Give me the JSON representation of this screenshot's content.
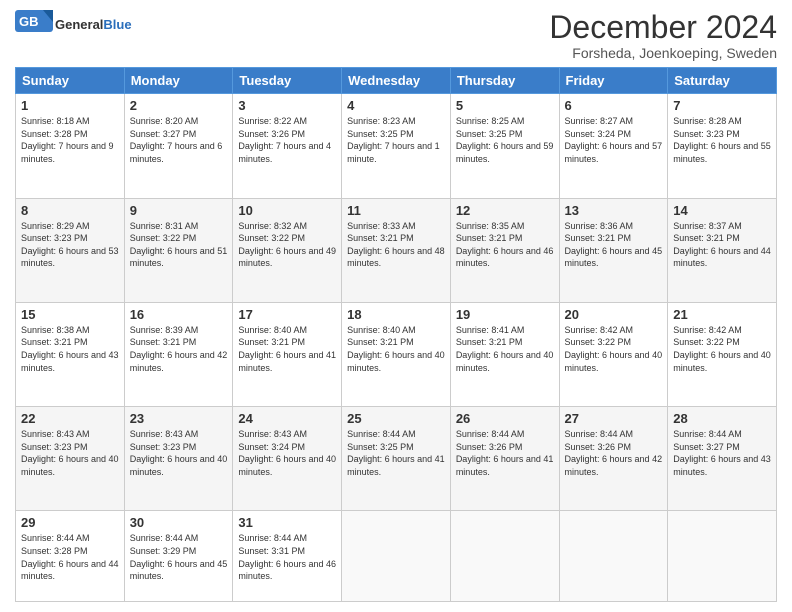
{
  "header": {
    "logo_general": "General",
    "logo_blue": "Blue",
    "month_title": "December 2024",
    "location": "Forsheda, Joenkoeping, Sweden"
  },
  "weekdays": [
    "Sunday",
    "Monday",
    "Tuesday",
    "Wednesday",
    "Thursday",
    "Friday",
    "Saturday"
  ],
  "weeks": [
    [
      {
        "day": "1",
        "sunrise": "8:18 AM",
        "sunset": "3:28 PM",
        "daylight": "7 hours and 9 minutes."
      },
      {
        "day": "2",
        "sunrise": "8:20 AM",
        "sunset": "3:27 PM",
        "daylight": "7 hours and 6 minutes."
      },
      {
        "day": "3",
        "sunrise": "8:22 AM",
        "sunset": "3:26 PM",
        "daylight": "7 hours and 4 minutes."
      },
      {
        "day": "4",
        "sunrise": "8:23 AM",
        "sunset": "3:25 PM",
        "daylight": "7 hours and 1 minute."
      },
      {
        "day": "5",
        "sunrise": "8:25 AM",
        "sunset": "3:25 PM",
        "daylight": "6 hours and 59 minutes."
      },
      {
        "day": "6",
        "sunrise": "8:27 AM",
        "sunset": "3:24 PM",
        "daylight": "6 hours and 57 minutes."
      },
      {
        "day": "7",
        "sunrise": "8:28 AM",
        "sunset": "3:23 PM",
        "daylight": "6 hours and 55 minutes."
      }
    ],
    [
      {
        "day": "8",
        "sunrise": "8:29 AM",
        "sunset": "3:23 PM",
        "daylight": "6 hours and 53 minutes."
      },
      {
        "day": "9",
        "sunrise": "8:31 AM",
        "sunset": "3:22 PM",
        "daylight": "6 hours and 51 minutes."
      },
      {
        "day": "10",
        "sunrise": "8:32 AM",
        "sunset": "3:22 PM",
        "daylight": "6 hours and 49 minutes."
      },
      {
        "day": "11",
        "sunrise": "8:33 AM",
        "sunset": "3:21 PM",
        "daylight": "6 hours and 48 minutes."
      },
      {
        "day": "12",
        "sunrise": "8:35 AM",
        "sunset": "3:21 PM",
        "daylight": "6 hours and 46 minutes."
      },
      {
        "day": "13",
        "sunrise": "8:36 AM",
        "sunset": "3:21 PM",
        "daylight": "6 hours and 45 minutes."
      },
      {
        "day": "14",
        "sunrise": "8:37 AM",
        "sunset": "3:21 PM",
        "daylight": "6 hours and 44 minutes."
      }
    ],
    [
      {
        "day": "15",
        "sunrise": "8:38 AM",
        "sunset": "3:21 PM",
        "daylight": "6 hours and 43 minutes."
      },
      {
        "day": "16",
        "sunrise": "8:39 AM",
        "sunset": "3:21 PM",
        "daylight": "6 hours and 42 minutes."
      },
      {
        "day": "17",
        "sunrise": "8:40 AM",
        "sunset": "3:21 PM",
        "daylight": "6 hours and 41 minutes."
      },
      {
        "day": "18",
        "sunrise": "8:40 AM",
        "sunset": "3:21 PM",
        "daylight": "6 hours and 40 minutes."
      },
      {
        "day": "19",
        "sunrise": "8:41 AM",
        "sunset": "3:21 PM",
        "daylight": "6 hours and 40 minutes."
      },
      {
        "day": "20",
        "sunrise": "8:42 AM",
        "sunset": "3:22 PM",
        "daylight": "6 hours and 40 minutes."
      },
      {
        "day": "21",
        "sunrise": "8:42 AM",
        "sunset": "3:22 PM",
        "daylight": "6 hours and 40 minutes."
      }
    ],
    [
      {
        "day": "22",
        "sunrise": "8:43 AM",
        "sunset": "3:23 PM",
        "daylight": "6 hours and 40 minutes."
      },
      {
        "day": "23",
        "sunrise": "8:43 AM",
        "sunset": "3:23 PM",
        "daylight": "6 hours and 40 minutes."
      },
      {
        "day": "24",
        "sunrise": "8:43 AM",
        "sunset": "3:24 PM",
        "daylight": "6 hours and 40 minutes."
      },
      {
        "day": "25",
        "sunrise": "8:44 AM",
        "sunset": "3:25 PM",
        "daylight": "6 hours and 41 minutes."
      },
      {
        "day": "26",
        "sunrise": "8:44 AM",
        "sunset": "3:26 PM",
        "daylight": "6 hours and 41 minutes."
      },
      {
        "day": "27",
        "sunrise": "8:44 AM",
        "sunset": "3:26 PM",
        "daylight": "6 hours and 42 minutes."
      },
      {
        "day": "28",
        "sunrise": "8:44 AM",
        "sunset": "3:27 PM",
        "daylight": "6 hours and 43 minutes."
      }
    ],
    [
      {
        "day": "29",
        "sunrise": "8:44 AM",
        "sunset": "3:28 PM",
        "daylight": "6 hours and 44 minutes."
      },
      {
        "day": "30",
        "sunrise": "8:44 AM",
        "sunset": "3:29 PM",
        "daylight": "6 hours and 45 minutes."
      },
      {
        "day": "31",
        "sunrise": "8:44 AM",
        "sunset": "3:31 PM",
        "daylight": "6 hours and 46 minutes."
      },
      null,
      null,
      null,
      null
    ]
  ]
}
